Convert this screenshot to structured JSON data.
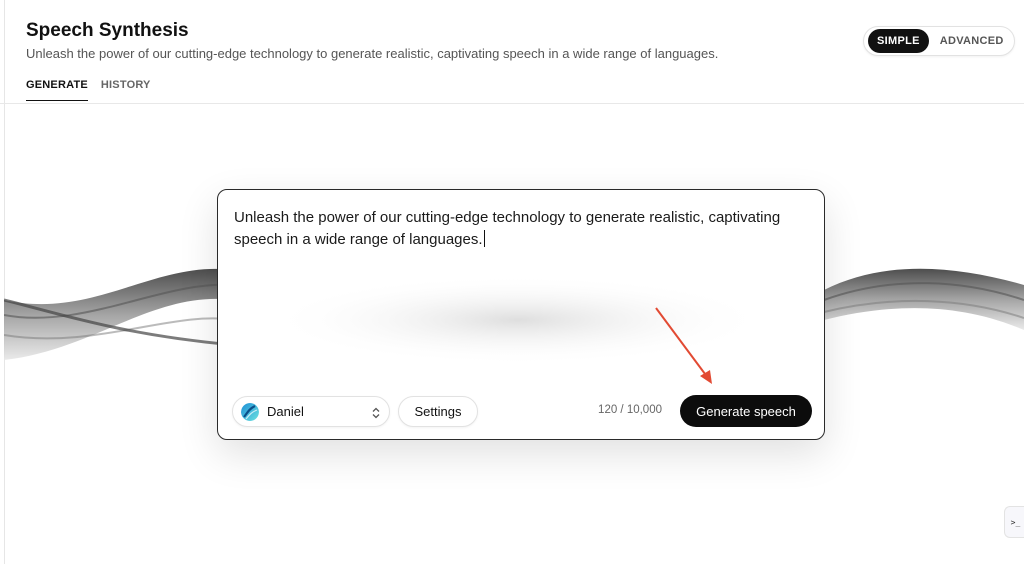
{
  "header": {
    "title": "Speech Synthesis",
    "subtitle": "Unleash the power of our cutting-edge technology to generate realistic, captivating speech in a wide range of languages."
  },
  "tabs": [
    {
      "label": "GENERATE",
      "active": true
    },
    {
      "label": "HISTORY",
      "active": false
    }
  ],
  "mode_toggle": {
    "options": [
      "SIMPLE",
      "ADVANCED"
    ],
    "selected": "SIMPLE"
  },
  "editor": {
    "text": "Unleash the power of our cutting-edge technology to generate realistic, captivating speech in a wide range of languages."
  },
  "voice": {
    "name": "Daniel",
    "avatar_icon": "gradient-orb-avatar",
    "selector_icon": "chevron-up-down-icon"
  },
  "settings_label": "Settings",
  "char_count": "120 / 10,000",
  "generate_label": "Generate speech",
  "side_widget_icon": ">_",
  "colors": {
    "primary": "#0c0c0c",
    "annotation_arrow": "#e24a33",
    "avatar_gradient": [
      "#1c8fd6",
      "#6fe3e0"
    ]
  }
}
